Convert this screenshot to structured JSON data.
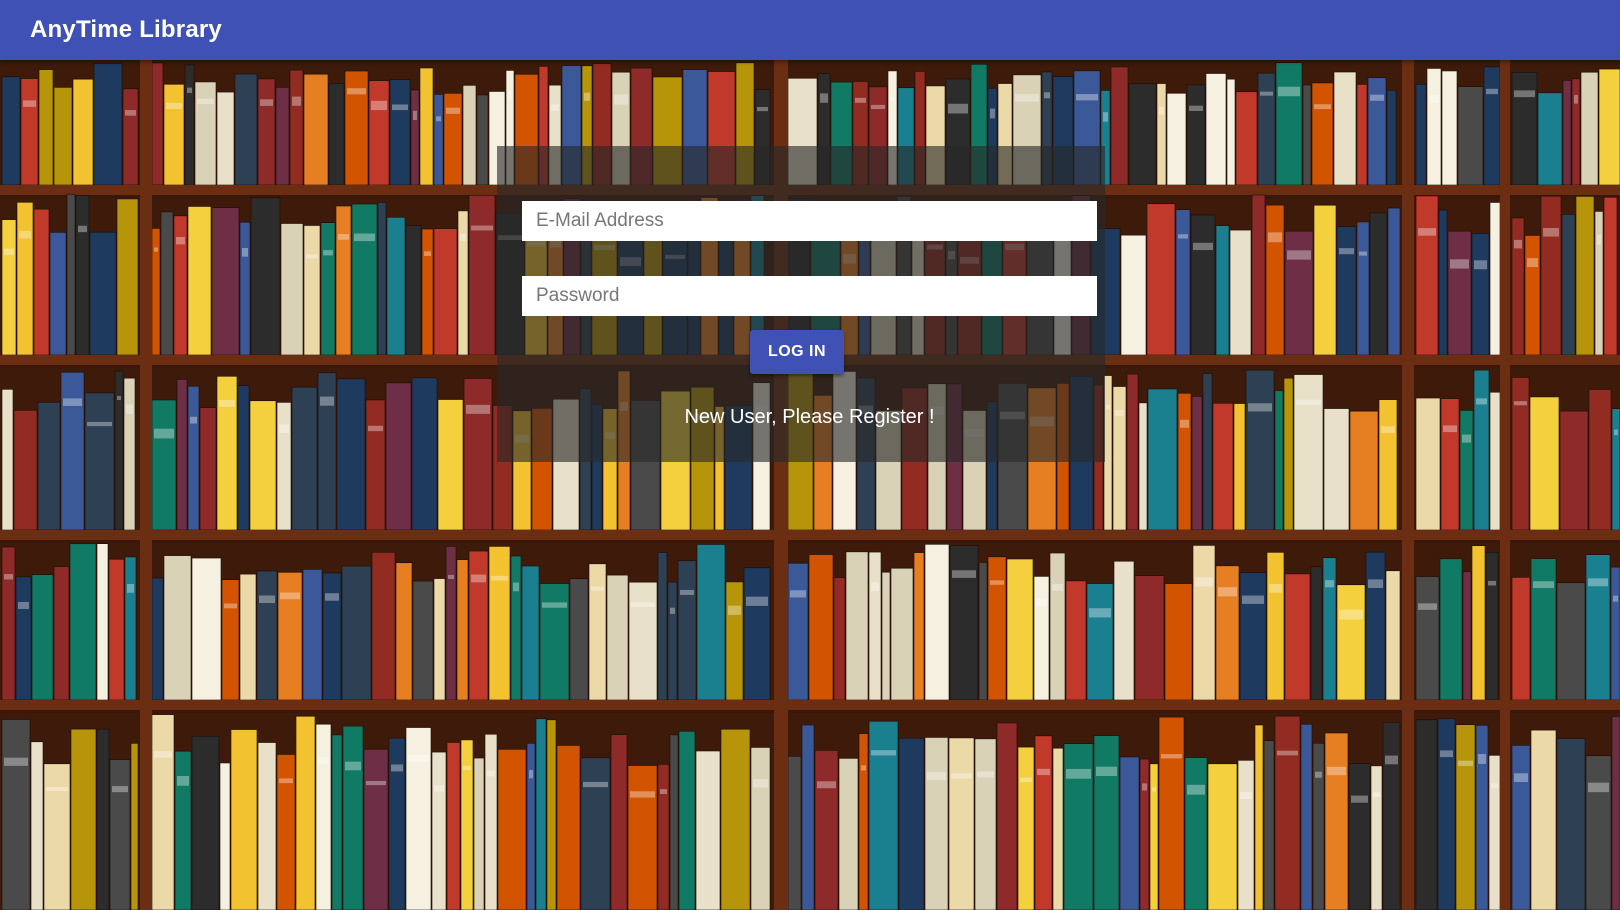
{
  "app": {
    "title": "AnyTime Library"
  },
  "login": {
    "email_placeholder": "E-Mail Address",
    "password_placeholder": "Password",
    "login_label": "LOG IN",
    "register_link": "New User, Please Register !"
  },
  "colors": {
    "app_bar": "#3f51b5",
    "button": "#3f51b5",
    "panel_overlay": "rgba(40,40,40,0.62)",
    "shelf_wood": "#6b2e12"
  },
  "background": {
    "image": "bookshelf-photo"
  }
}
